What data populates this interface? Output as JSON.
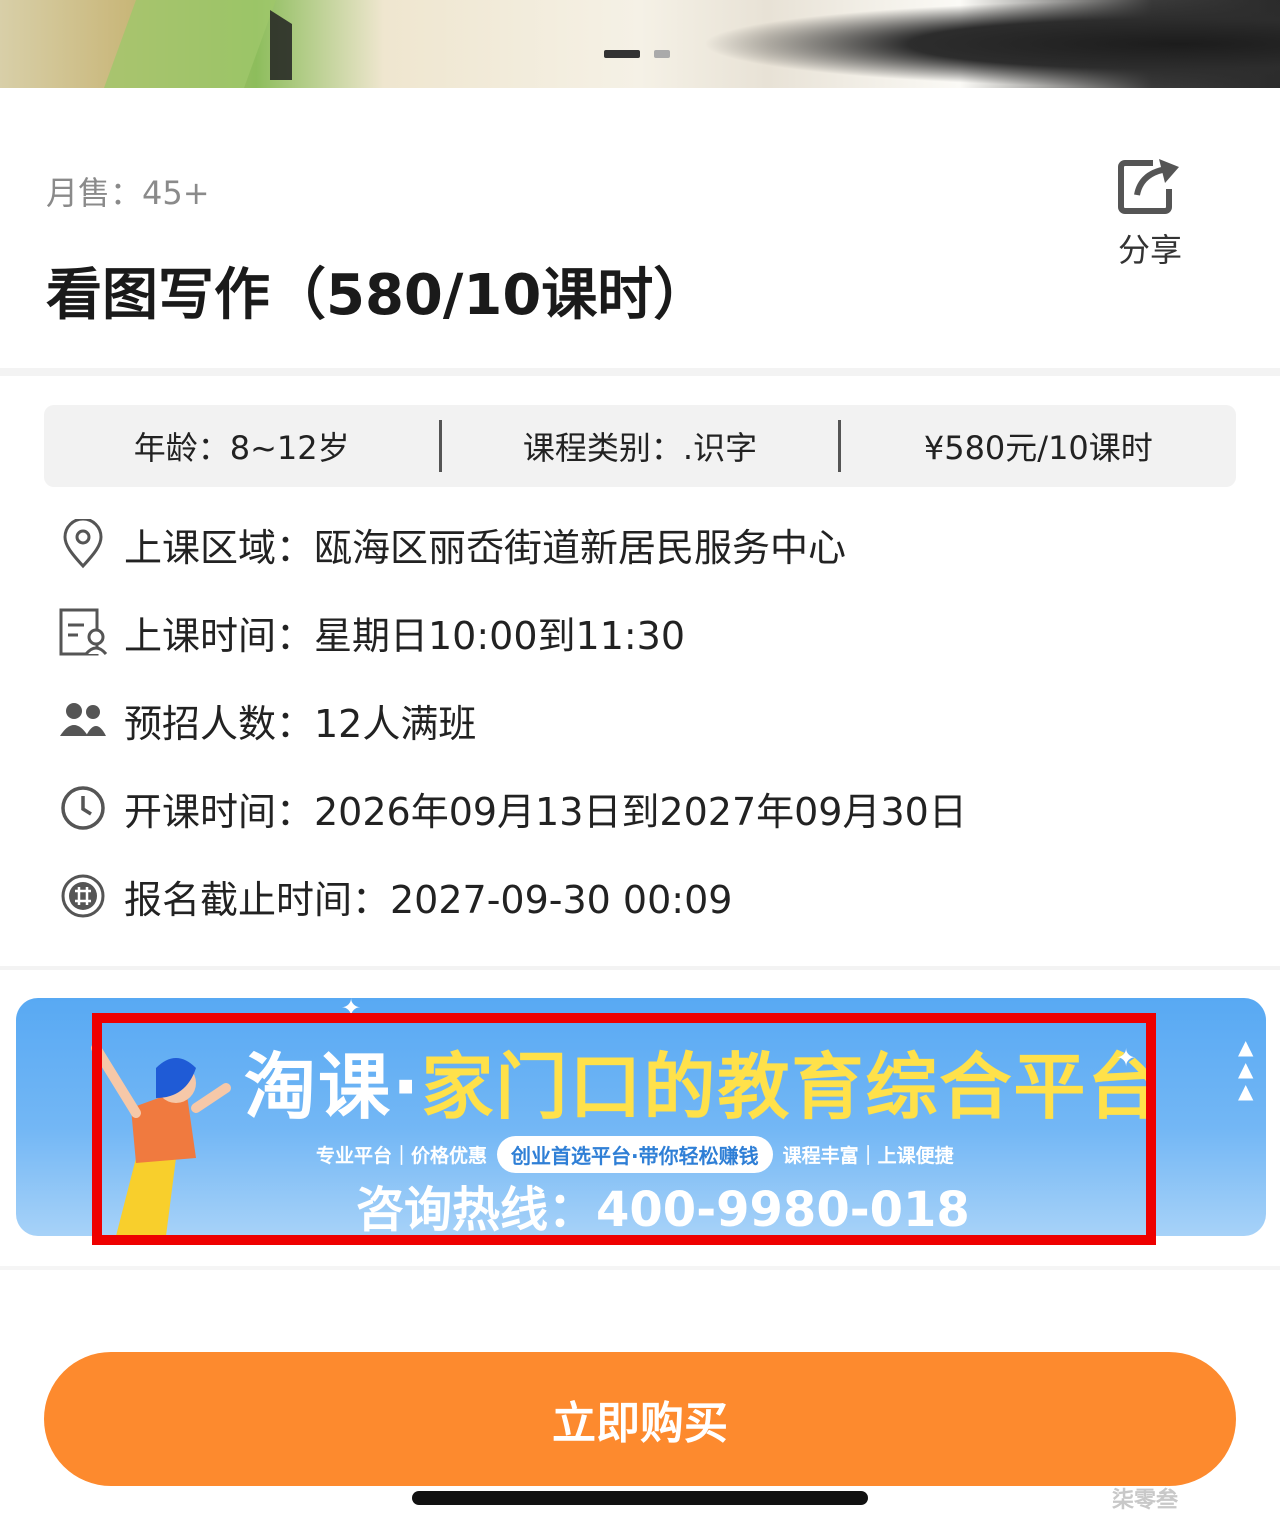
{
  "product": {
    "sales_label": "月售：45+",
    "title": "看图写作（580/10课时）",
    "share_label": "分享"
  },
  "specs": {
    "age": "年龄：8~12岁",
    "category": "课程类别：.识字",
    "price": "¥580元/10课时"
  },
  "details": [
    {
      "icon": "location-pin-icon",
      "text": "上课区域：瓯海区丽岙街道新居民服务中心"
    },
    {
      "icon": "schedule-icon",
      "text": "上课时间：星期日10:00到11:30"
    },
    {
      "icon": "people-icon",
      "text": "预招人数：12人满班"
    },
    {
      "icon": "clock-icon",
      "text": "开课时间：2026年09月13日到2027年09月30日"
    },
    {
      "icon": "enroll-icon",
      "text": "报名截止时间：2027-09-30 00:09"
    }
  ],
  "banner": {
    "headline_a": "淘课·",
    "headline_b": "家门口的教育综合平台",
    "tag1": "专业平台｜价格优惠",
    "pill": "创业首选平台·带你轻松赚钱",
    "tag2": "课程丰富｜上课便捷",
    "hotline": "咨询热线：400-9980-018"
  },
  "buy_button_label": "立即购买",
  "watermark": "柒零叁"
}
